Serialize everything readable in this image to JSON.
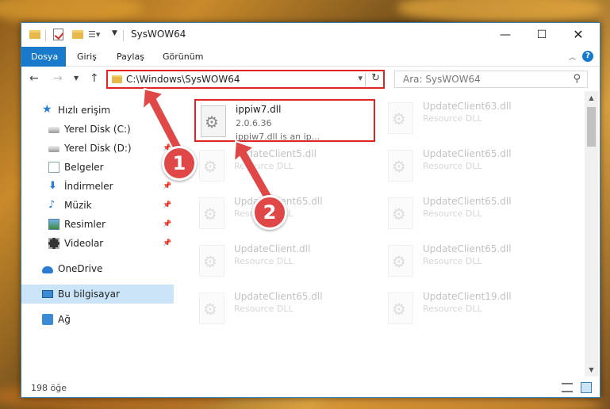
{
  "window": {
    "title": "SysWOW64"
  },
  "ribbon": {
    "tabs": [
      {
        "label": "Dosya",
        "active": true
      },
      {
        "label": "Giriş"
      },
      {
        "label": "Paylaş"
      },
      {
        "label": "Görünüm"
      }
    ]
  },
  "nav": {
    "address": "C:\\Windows\\SysWOW64",
    "search_placeholder": "Ara: SysWOW64"
  },
  "sidebar": {
    "items": [
      {
        "label": "Hızlı erişim"
      },
      {
        "label": "Yerel Disk (C:)"
      },
      {
        "label": "Yerel Disk (D:)"
      },
      {
        "label": "Belgeler"
      },
      {
        "label": "İndirmeler"
      },
      {
        "label": "Müzik"
      },
      {
        "label": "Resimler"
      },
      {
        "label": "Videolar"
      },
      {
        "label": "OneDrive"
      },
      {
        "label": "Bu bilgisayar",
        "selected": true
      },
      {
        "label": "Ağ"
      }
    ]
  },
  "files": [
    {
      "name": "ippiw7.dll",
      "version": "2.0.6.36",
      "desc": "ippiw7.dll is an ip...",
      "highlighted": true
    },
    {
      "name": "UpdateClient63.dll",
      "desc": "Resource DLL"
    },
    {
      "name": "UpdateClient5.dll",
      "desc": "Resource DLL"
    },
    {
      "name": "UpdateClient65.dll",
      "desc": "Resource DLL"
    },
    {
      "name": "UpdateClient65.dll",
      "desc": "Resource DLL"
    },
    {
      "name": "UpdateClient65.dll",
      "desc": "Resource DLL"
    },
    {
      "name": "UpdateClient.dll",
      "desc": "Resource DLL"
    },
    {
      "name": "UpdateClient65.dll",
      "desc": "Resource DLL"
    },
    {
      "name": "UpdateClient65.dll",
      "desc": "Resource DLL"
    },
    {
      "name": "UpdateClient19.dll",
      "desc": "Resource DLL"
    }
  ],
  "status": {
    "count": "198 öğe"
  },
  "annotations": {
    "step1": "1",
    "step2": "2"
  },
  "colors": {
    "accent": "#1979ca",
    "highlight": "#e02424",
    "badge": "#e04848"
  }
}
